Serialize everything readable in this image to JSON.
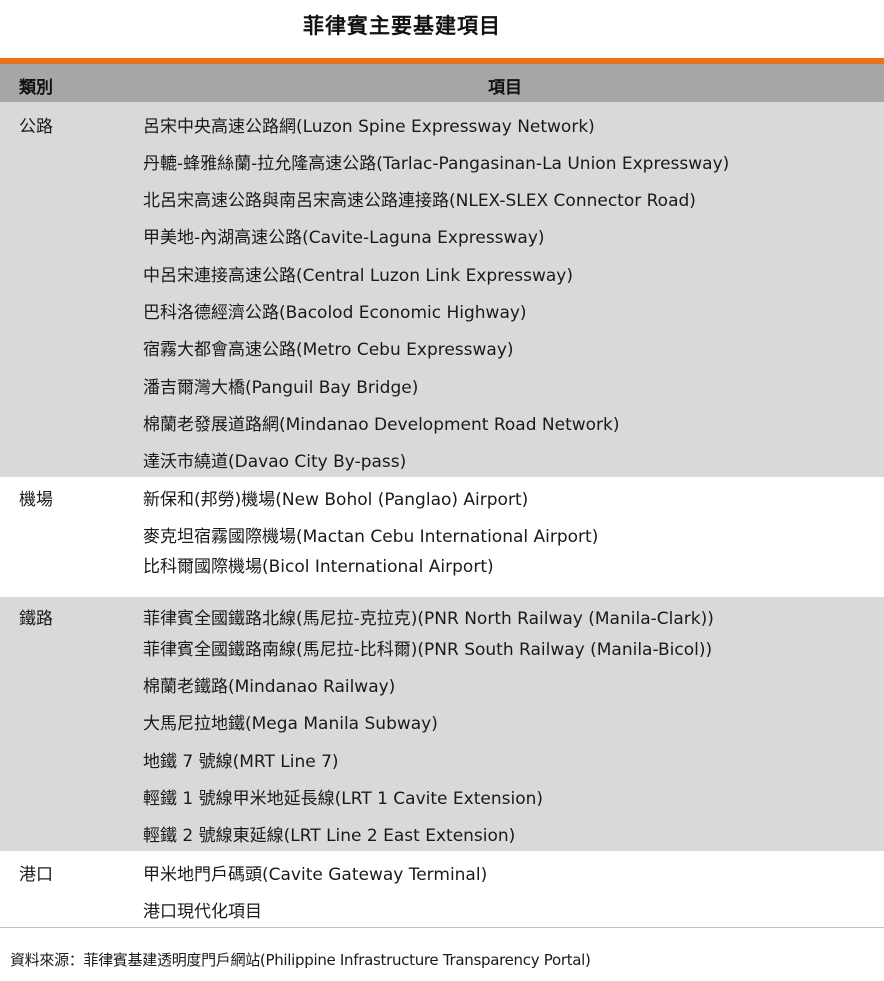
{
  "title": "菲律賓主要基建項目",
  "header": {
    "category": "類別",
    "project": "項目"
  },
  "groups": [
    {
      "category": "公路",
      "items": [
        "呂宋中央高速公路網(Luzon Spine Expressway Network)",
        "丹轆-蜂雅絲蘭-拉允隆高速公路(Tarlac-Pangasinan-La Union Expressway)",
        "北呂宋高速公路與南呂宋高速公路連接路(NLEX-SLEX Connector Road)",
        "甲美地-內湖高速公路(Cavite-Laguna Expressway)",
        "中呂宋連接高速公路(Central Luzon Link Expressway)",
        "巴科洛德經濟公路(Bacolod Economic Highway)",
        "宿霧大都會高速公路(Metro Cebu Expressway)",
        "潘吉爾灣大橋(Panguil Bay Bridge)",
        "棉蘭老發展道路網(Mindanao Development Road Network)",
        "達沃市繞道(Davao City By-pass)"
      ]
    },
    {
      "category": "機場",
      "items": [
        "新保和(邦勞)機場(New Bohol (Panglao) Airport)",
        "麥克坦宿霧國際機場(Mactan Cebu International Airport)",
        "比科爾國際機場(Bicol International Airport)"
      ]
    },
    {
      "category": "鐵路",
      "items": [
        "菲律賓全國鐵路北線(馬尼拉-克拉克)(PNR North Railway (Manila-Clark))",
        "菲律賓全國鐵路南線(馬尼拉-比科爾)(PNR South Railway (Manila-Bicol))",
        "棉蘭老鐵路(Mindanao Railway)",
        "大馬尼拉地鐵(Mega Manila Subway)",
        "地鐵 7 號線(MRT Line 7)",
        "輕鐵 1 號線甲米地延長線(LRT 1 Cavite Extension)",
        "輕鐵 2 號線東延線(LRT Line 2 East Extension)"
      ]
    },
    {
      "category": "港口",
      "items": [
        "甲米地門戶碼頭(Cavite Gateway Terminal)",
        "港口現代化項目"
      ]
    }
  ],
  "source": "資料來源：菲律賓基建透明度門戶網站(Philippine Infrastructure Transparency Portal)",
  "colors": {
    "accent": "#e8721c",
    "header_bg": "#a6a6a6",
    "row_shade": "#d9d9d9"
  }
}
